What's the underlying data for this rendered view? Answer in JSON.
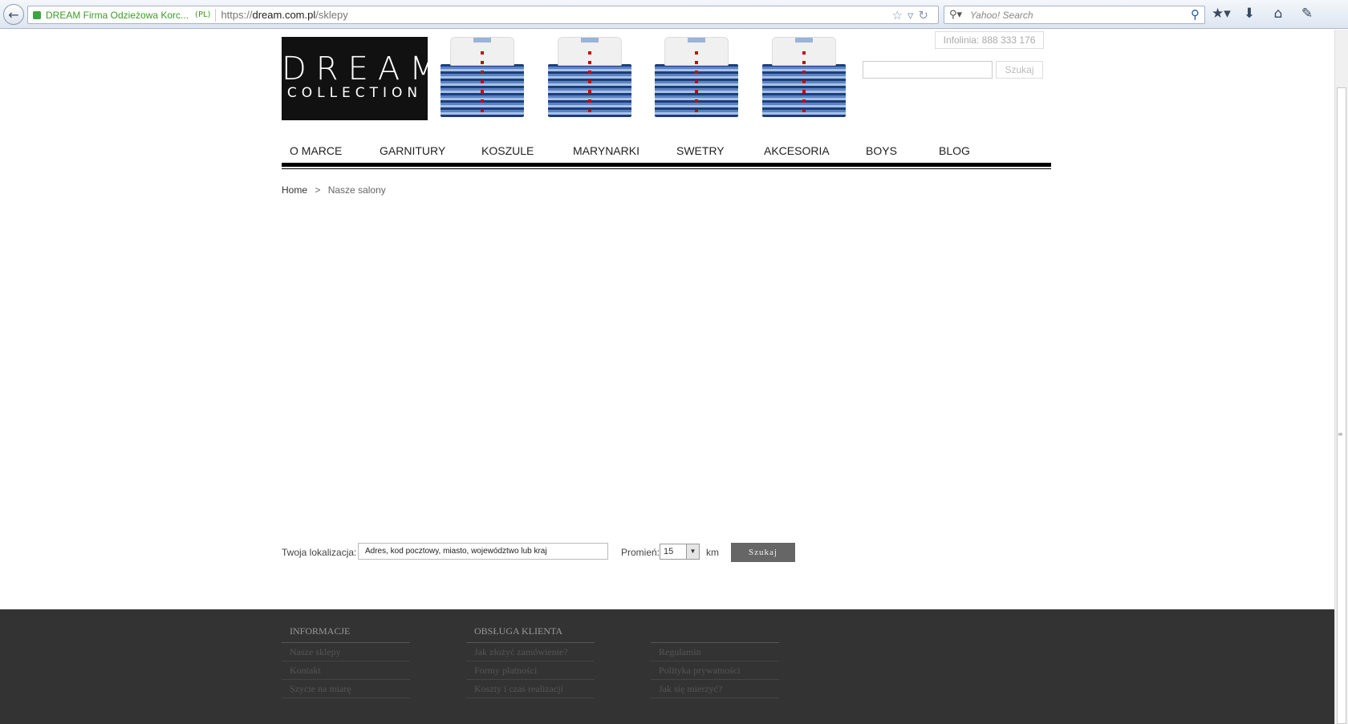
{
  "browser": {
    "site_identity": "DREAM Firma Odzieżowa Korc...",
    "site_country": "(PL)",
    "url_prefix": "https://",
    "url_domain": "dream.com.pl",
    "url_path": "/sklepy",
    "search_placeholder": "Yahoo! Search"
  },
  "header": {
    "logo_line1": "DREAM",
    "logo_line2": "COLLECTION",
    "infolinia": "Infolinia: 888 333 176",
    "search_button": "Szukaj"
  },
  "nav": {
    "items": [
      "O MARCE",
      "GARNITURY",
      "KOSZULE",
      "MARYNARKI",
      "SWETRY",
      "AKCESORIA",
      "BOYS",
      "BLOG"
    ]
  },
  "breadcrumb": {
    "home": "Home",
    "separator": ">",
    "current": "Nasze salony"
  },
  "locator": {
    "label": "Twoja lokalizacja:",
    "input_value": "Adres, kod pocztowy, miasto, województwo lub kraj",
    "radius_label": "Promień:",
    "radius_value": "15",
    "unit": "km",
    "button": "Szukaj"
  },
  "footer": {
    "col1": {
      "heading": "INFORMACJE",
      "links": [
        "Nasze sklepy",
        "Kontakt",
        "Szycie na miarę"
      ]
    },
    "col2": {
      "heading": "OBSŁUGA KLIENTA",
      "links": [
        "Jak złożyć zamówienie?",
        "Formy płatności",
        "Koszty i czas realizacji"
      ]
    },
    "col3": {
      "heading": "",
      "links": [
        "Regulamin",
        "Polityka prywatności",
        "Jak się mierzyć?"
      ]
    }
  }
}
